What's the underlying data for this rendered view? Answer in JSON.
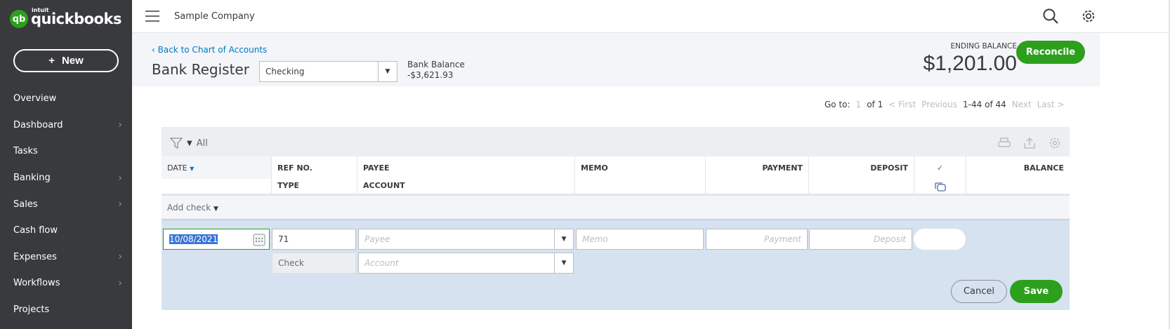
{
  "app": {
    "logo_brand": "intuit",
    "logo_name": "quickbooks",
    "logo_mark": "qb",
    "new_label": "New"
  },
  "sidebar": {
    "items": [
      {
        "label": "Overview",
        "chevron": false
      },
      {
        "label": "Dashboard",
        "chevron": true
      },
      {
        "label": "Tasks",
        "chevron": false
      },
      {
        "label": "Banking",
        "chevron": true
      },
      {
        "label": "Sales",
        "chevron": true
      },
      {
        "label": "Cash flow",
        "chevron": false
      },
      {
        "label": "Expenses",
        "chevron": true
      },
      {
        "label": "Workflows",
        "chevron": true
      },
      {
        "label": "Projects",
        "chevron": false
      }
    ]
  },
  "header": {
    "company": "Sample Company"
  },
  "page": {
    "back_link": "Back to Chart of Accounts",
    "title": "Bank Register",
    "account": "Checking",
    "bank_balance_label": "Bank Balance",
    "bank_balance": "-$3,621.93",
    "ending_balance_label": "ENDING BALANCE",
    "ending_balance": "$1,201.00",
    "reconcile": "Reconcile"
  },
  "pager": {
    "goto": "Go to:",
    "page": "1",
    "of": "of 1",
    "first": "< First",
    "previous": "Previous",
    "range": "1-44 of 44",
    "next": "Next",
    "last": "Last >"
  },
  "filter": {
    "label": "All"
  },
  "columns": {
    "date": "DATE",
    "ref": "REF NO.",
    "type": "TYPE",
    "payee": "PAYEE",
    "account": "ACCOUNT",
    "memo": "MEMO",
    "payment": "PAYMENT",
    "deposit": "DEPOSIT",
    "cleared": "✓",
    "balance": "BALANCE"
  },
  "add_check": "Add check",
  "entry": {
    "date": "10/08/2021",
    "ref": "71",
    "type": "Check",
    "payee_ph": "Payee",
    "account_ph": "Account",
    "memo_ph": "Memo",
    "payment_ph": "Payment",
    "deposit_ph": "Deposit",
    "cancel": "Cancel",
    "save": "Save"
  }
}
